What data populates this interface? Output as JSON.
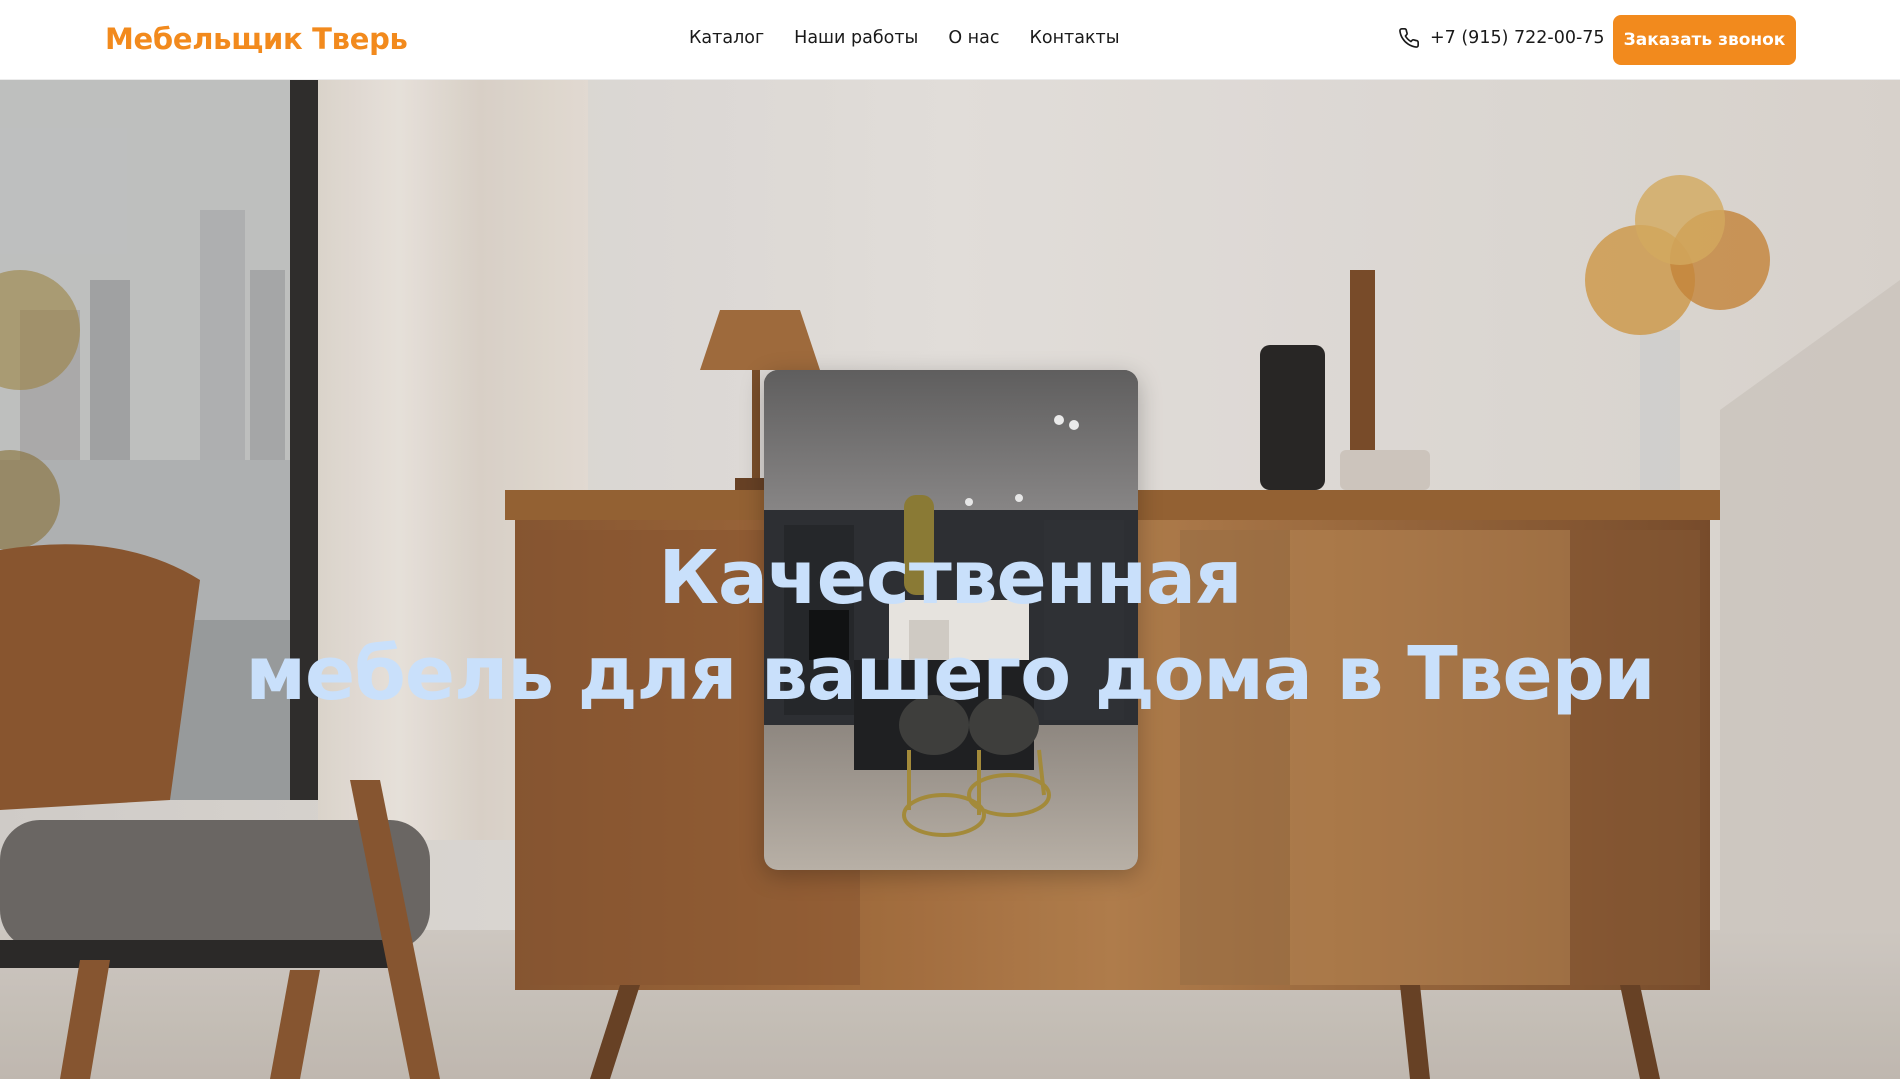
{
  "header": {
    "logo": "Мебельщик Тверь",
    "nav": [
      {
        "label": "Каталог"
      },
      {
        "label": "Наши работы"
      },
      {
        "label": "О нас"
      },
      {
        "label": "Контакты"
      }
    ],
    "phone": "+7 (915) 722-00-75",
    "phone_icon": "phone-icon",
    "cta_label": "Заказать звонок"
  },
  "hero": {
    "title_line1": "Качественная",
    "title_line2": "мебель для вашего дома в Твери",
    "background_image": "living-room-sideboard-photo",
    "inset_image": "kitchen-photo"
  },
  "colors": {
    "accent": "#f28a1d",
    "hero_title": "#c9e0fb",
    "text": "#1a1a1a"
  }
}
